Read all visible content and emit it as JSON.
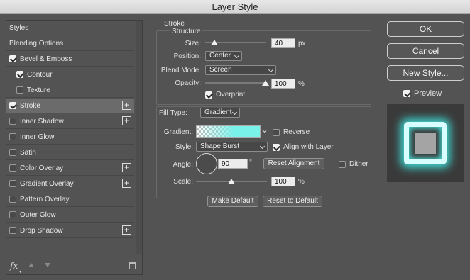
{
  "window": {
    "title": "Layer Style"
  },
  "left": {
    "items": [
      {
        "label": "Styles",
        "checkbox": false,
        "checked": false,
        "plus": false,
        "selected": false,
        "indent": 0
      },
      {
        "label": "Blending Options",
        "checkbox": false,
        "checked": false,
        "plus": false,
        "selected": false,
        "indent": 0
      },
      {
        "label": "Bevel & Emboss",
        "checkbox": true,
        "checked": true,
        "plus": false,
        "selected": false,
        "indent": 0
      },
      {
        "label": "Contour",
        "checkbox": true,
        "checked": true,
        "plus": false,
        "selected": false,
        "indent": 1
      },
      {
        "label": "Texture",
        "checkbox": true,
        "checked": false,
        "plus": false,
        "selected": false,
        "indent": 1
      },
      {
        "label": "Stroke",
        "checkbox": true,
        "checked": true,
        "plus": true,
        "selected": true,
        "indent": 0
      },
      {
        "label": "Inner Shadow",
        "checkbox": true,
        "checked": false,
        "plus": true,
        "selected": false,
        "indent": 0
      },
      {
        "label": "Inner Glow",
        "checkbox": true,
        "checked": false,
        "plus": false,
        "selected": false,
        "indent": 0
      },
      {
        "label": "Satin",
        "checkbox": true,
        "checked": false,
        "plus": false,
        "selected": false,
        "indent": 0
      },
      {
        "label": "Color Overlay",
        "checkbox": true,
        "checked": false,
        "plus": true,
        "selected": false,
        "indent": 0
      },
      {
        "label": "Gradient Overlay",
        "checkbox": true,
        "checked": false,
        "plus": true,
        "selected": false,
        "indent": 0
      },
      {
        "label": "Pattern Overlay",
        "checkbox": true,
        "checked": false,
        "plus": false,
        "selected": false,
        "indent": 0
      },
      {
        "label": "Outer Glow",
        "checkbox": true,
        "checked": false,
        "plus": false,
        "selected": false,
        "indent": 0
      },
      {
        "label": "Drop Shadow",
        "checkbox": true,
        "checked": false,
        "plus": true,
        "selected": false,
        "indent": 0
      }
    ],
    "footer": {
      "fx_label": "fx"
    }
  },
  "stroke": {
    "title": "Stroke",
    "structure_title": "Structure",
    "size_label": "Size:",
    "size_value": "40",
    "size_unit": "px",
    "size_fraction": 0.15,
    "position_label": "Position:",
    "position_value": "Center",
    "blend_label": "Blend Mode:",
    "blend_value": "Screen",
    "opacity_label": "Opacity:",
    "opacity_value": "100",
    "opacity_unit": "%",
    "opacity_fraction": 1.0,
    "overprint_label": "Overprint",
    "overprint_checked": true,
    "filltype_label": "Fill Type:",
    "filltype_value": "Gradient",
    "gradient_label": "Gradient:",
    "reverse_label": "Reverse",
    "reverse_checked": false,
    "style_label": "Style:",
    "style_value": "Shape Burst",
    "align_label": "Align with Layer",
    "align_checked": true,
    "angle_label": "Angle:",
    "angle_value": "90",
    "angle_unit": "°",
    "reset_alignment_label": "Reset Alignment",
    "dither_label": "Dither",
    "dither_checked": false,
    "scale_label": "Scale:",
    "scale_value": "100",
    "scale_unit": "%",
    "scale_fraction": 0.5,
    "make_default_label": "Make Default",
    "reset_default_label": "Reset to Default",
    "gradient_color": "#79f2ea"
  },
  "right": {
    "ok_label": "OK",
    "cancel_label": "Cancel",
    "new_style_label": "New Style...",
    "preview_label": "Preview",
    "preview_checked": true
  }
}
